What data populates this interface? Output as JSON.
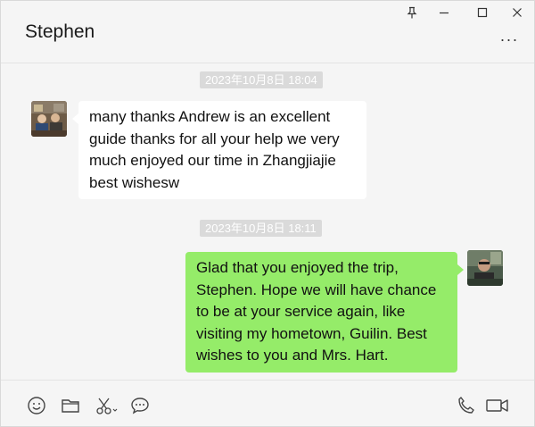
{
  "window": {
    "contact_name": "Stephen",
    "controls": [
      "pin-icon",
      "minimize-icon",
      "maximize-icon",
      "close-icon"
    ],
    "more_label": "···"
  },
  "messages": [
    {
      "timestamp": "2023年10月8日 18:04",
      "sender": "incoming",
      "text": "many thanks Andrew is an excellent guide thanks for all your help we very much enjoyed our time in Zhangjiajie best wishesw"
    },
    {
      "timestamp": "2023年10月8日 18:11",
      "sender": "outgoing",
      "text": "Glad that you enjoyed the trip, Stephen. Hope we will have chance to be at your service again, like visiting my hometown, Guilin. Best wishes to you and Mrs. Hart."
    }
  ],
  "toolbar": {
    "left_tools": [
      "emoji-icon",
      "folder-icon",
      "scissors-icon",
      "chat-bubble-icon"
    ],
    "right_tools": [
      "phone-icon",
      "video-icon"
    ]
  },
  "colors": {
    "incoming_bubble": "#ffffff",
    "outgoing_bubble": "#95ec69",
    "background": "#f5f5f5",
    "timestamp_bg": "#dadada"
  }
}
